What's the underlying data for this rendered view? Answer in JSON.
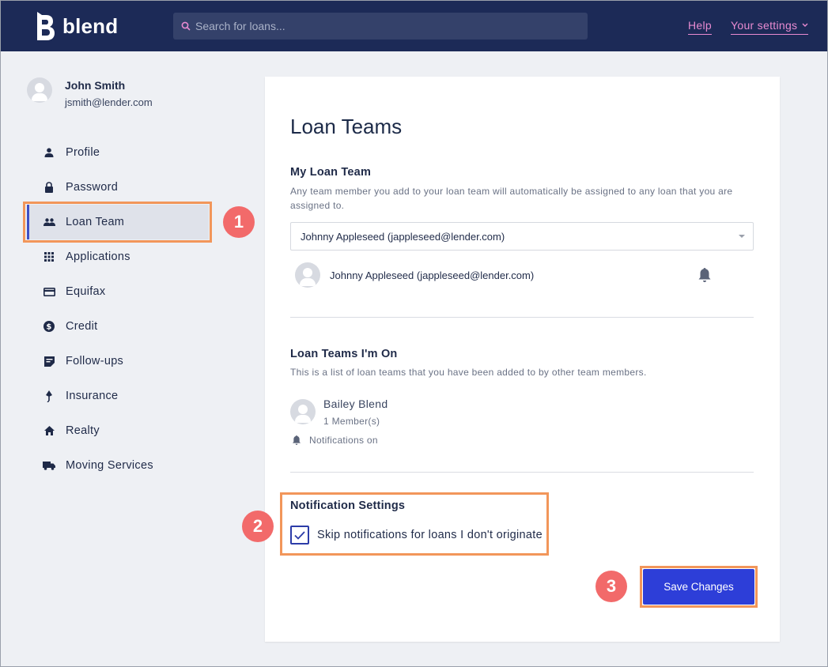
{
  "header": {
    "logo_text": "blend",
    "search_placeholder": "Search for loans...",
    "help_label": "Help",
    "settings_label": "Your settings"
  },
  "user": {
    "name": "John Smith",
    "email": "jsmith@lender.com"
  },
  "sidebar": {
    "items": [
      {
        "label": "Profile",
        "icon": "person-icon"
      },
      {
        "label": "Password",
        "icon": "lock-icon"
      },
      {
        "label": "Loan Team",
        "icon": "people-icon",
        "active": true
      },
      {
        "label": "Applications",
        "icon": "grid-icon"
      },
      {
        "label": "Equifax",
        "icon": "credit-card-icon"
      },
      {
        "label": "Credit",
        "icon": "dollar-circle-icon"
      },
      {
        "label": "Follow-ups",
        "icon": "note-icon"
      },
      {
        "label": "Insurance",
        "icon": "umbrella-icon"
      },
      {
        "label": "Realty",
        "icon": "home-icon"
      },
      {
        "label": "Moving Services",
        "icon": "truck-icon"
      }
    ]
  },
  "main": {
    "title": "Loan Teams",
    "my_team": {
      "heading": "My Loan Team",
      "description": "Any team member you add to your loan team will automatically be assigned to any loan that you are assigned to.",
      "select_value": "Johnny Appleseed (jappleseed@lender.com)",
      "members": [
        {
          "name": "Johnny Appleseed (jappleseed@lender.com)"
        }
      ]
    },
    "teams_on": {
      "heading": "Loan Teams I'm On",
      "description": "This is a list of loan teams that you have been added to by other team members.",
      "team_name": "Bailey Blend",
      "member_count": "1 Member(s)",
      "notifications": "Notifications on"
    },
    "notification_settings": {
      "heading": "Notification Settings",
      "checkbox_label": "Skip notifications for loans I don't originate",
      "checked": true
    },
    "save_label": "Save Changes"
  },
  "annotations": [
    "1",
    "2",
    "3"
  ],
  "colors": {
    "topbar": "#1c2a57",
    "accent_link": "#e88bd1",
    "primary_button": "#2d3ed8",
    "highlight": "#f2965a",
    "badge": "#f26a6a"
  }
}
